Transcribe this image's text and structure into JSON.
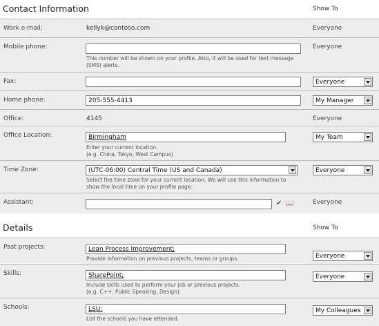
{
  "contact": {
    "title": "Contact Information",
    "show_to": "Show To",
    "work_email": {
      "label": "Work e-mail:",
      "value": "kellyk@contoso.com",
      "visibility": "Everyone"
    },
    "mobile": {
      "label": "Mobile phone:",
      "value": "",
      "help": "This number will be shown on your profile. Also, it will be used for text message (SMS) alerts.",
      "visibility": "Everyone"
    },
    "fax": {
      "label": "Fax:",
      "value": "",
      "visibility": "Everyone"
    },
    "home_phone": {
      "label": "Home phone:",
      "value": "205-555-4413",
      "visibility": "My Manager"
    },
    "office": {
      "label": "Office:",
      "value": "4145",
      "visibility": "Everyone"
    },
    "office_location": {
      "label": "Office Location:",
      "value": "Birmingham",
      "help_1": "Enter your current location.",
      "help_2": "(e.g. China, Tokyo, West Campus)",
      "visibility": "My Team"
    },
    "time_zone": {
      "label": "Time Zone:",
      "value": "(UTC-06:00) Central Time (US and Canada)",
      "help_1": "Select the time zone for your current location. We will use this information to",
      "help_2": "show the local time on your profile page.",
      "visibility": "Everyone"
    },
    "assistant": {
      "label": "Assistant:",
      "value": "",
      "visibility": "Everyone",
      "icons": [
        "check-names-icon",
        "address-book-icon"
      ]
    }
  },
  "details": {
    "title": "Details",
    "show_to": "Show To",
    "past_projects": {
      "label": "Past projects:",
      "value": "Lean Process Improvement;",
      "help": "Provide information on previous projects, teams or groups.",
      "visibility": "Everyone"
    },
    "skills": {
      "label": "Skills:",
      "value": "SharePoint;",
      "help_1": "Include skills used to perform your job or previous projects.",
      "help_2": "(e.g. C++, Public Speaking, Design)",
      "visibility": "Everyone"
    },
    "schools": {
      "label": "Schools:",
      "value": "LSU;",
      "help": "List the schools you have attended.",
      "visibility": "My Colleagues"
    }
  }
}
